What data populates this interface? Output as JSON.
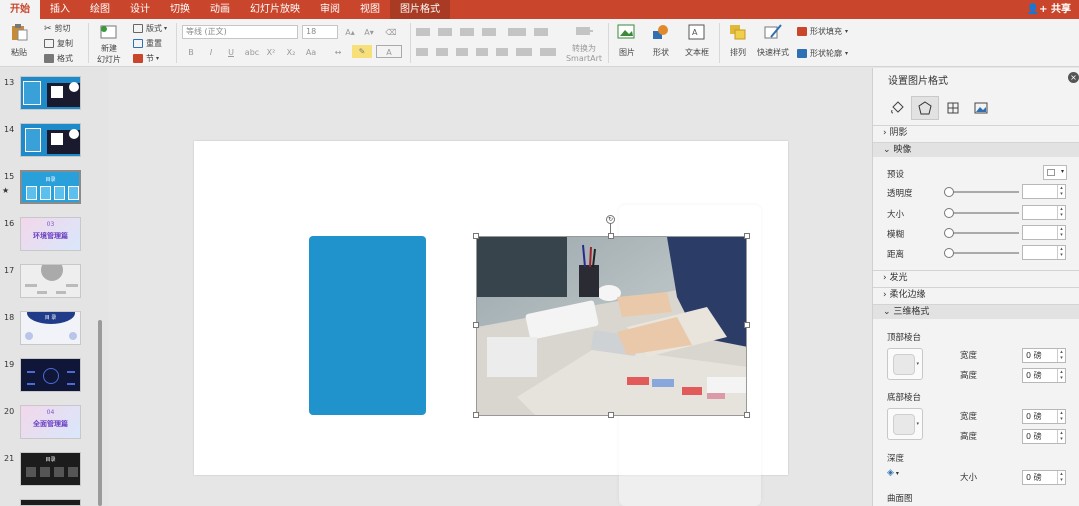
{
  "ribbon_tabs": [
    "开始",
    "插入",
    "绘图",
    "设计",
    "切换",
    "动画",
    "幻灯片放映",
    "审阅",
    "视图",
    "图片格式"
  ],
  "share_label": "共享",
  "home": {
    "paste": "粘贴",
    "cut": "剪切",
    "copy": "复制",
    "format": "格式",
    "new_slide_line1": "新建",
    "new_slide_line2": "幻灯片",
    "layout": "版式",
    "reset": "重置",
    "section": "节",
    "font_name": "等线 (正文)",
    "font_size": "18",
    "convert_line1": "转换为",
    "convert_line2": "SmartArt",
    "picture": "图片",
    "shapes": "形状",
    "textbox": "文本框",
    "arrange": "排列",
    "quick_styles": "快速样式",
    "shape_fill": "形状填充",
    "shape_outline": "形状轮廓",
    "format_buttons": [
      "B",
      "I",
      "U",
      "abc",
      "X²",
      "X₂",
      "Aa",
      "A"
    ]
  },
  "slides": [
    {
      "num": "13",
      "star": ""
    },
    {
      "num": "14",
      "star": ""
    },
    {
      "num": "15",
      "star": "★"
    },
    {
      "num": "16",
      "star": ""
    },
    {
      "num": "17",
      "star": ""
    },
    {
      "num": "18",
      "star": ""
    },
    {
      "num": "19",
      "star": ""
    },
    {
      "num": "20",
      "star": ""
    },
    {
      "num": "21",
      "star": ""
    }
  ],
  "thumb_text": {
    "t15": "目录",
    "t16_num": "03",
    "t16_title": "环境管理篇",
    "t18": "目 录",
    "t20_num": "04",
    "t20_title": "全面管理篇",
    "t21": "目录"
  },
  "colors": {
    "accent": "#c9462c",
    "shape_blue": "#2193cc",
    "pane_bg": "#f3f3f3"
  },
  "pane": {
    "title": "设置图片格式",
    "sections": {
      "shadow": "阴影",
      "reflection": "映像",
      "glow": "发光",
      "soft_edges": "柔化边缘",
      "three_d": "三维格式"
    },
    "reflection": {
      "preset": "预设",
      "transparency": "透明度",
      "size": "大小",
      "blur": "模糊",
      "distance": "距离"
    },
    "three_d": {
      "top_bevel": "顶部棱台",
      "bottom_bevel": "底部棱台",
      "width": "宽度",
      "height": "高度",
      "depth": "深度",
      "size": "大小",
      "contour": "曲面图",
      "top_width_val": "0 磅",
      "top_height_val": "0 磅",
      "bottom_width_val": "0 磅",
      "bottom_height_val": "0 磅",
      "depth_size_val": "0 磅"
    }
  }
}
